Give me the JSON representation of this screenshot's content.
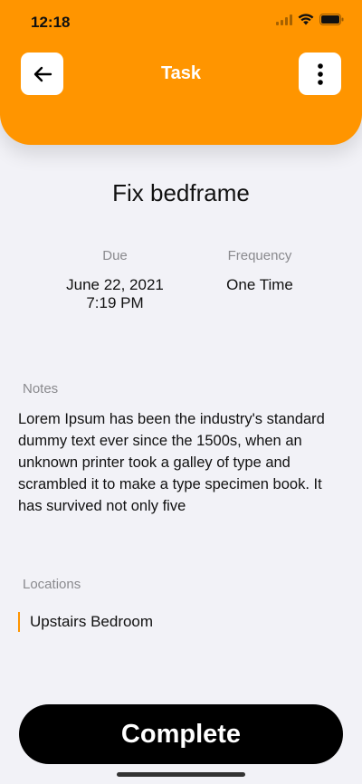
{
  "status_bar": {
    "time": "12:18"
  },
  "header": {
    "title": "Task"
  },
  "task": {
    "title": "Fix bedframe",
    "due_label": "Due",
    "due_date": "June 22, 2021",
    "due_time": "7:19 PM",
    "frequency_label": "Frequency",
    "frequency_value": "One Time",
    "notes_label": "Notes",
    "notes_text": "Lorem Ipsum has been the industry's standard dummy text ever since the 1500s, when an unknown printer took a galley of type and scrambled it to make a type specimen book. It has survived not only five",
    "locations_label": "Locations",
    "locations": [
      "Upstairs Bedroom"
    ]
  },
  "actions": {
    "complete_label": "Complete"
  },
  "colors": {
    "accent": "#ff9500",
    "background": "#f2f2f7",
    "button": "#000000"
  },
  "icons": {
    "back": "arrow-left-icon",
    "more": "more-vertical-icon",
    "signal": "cellular-signal-icon",
    "wifi": "wifi-icon",
    "battery": "battery-icon"
  }
}
